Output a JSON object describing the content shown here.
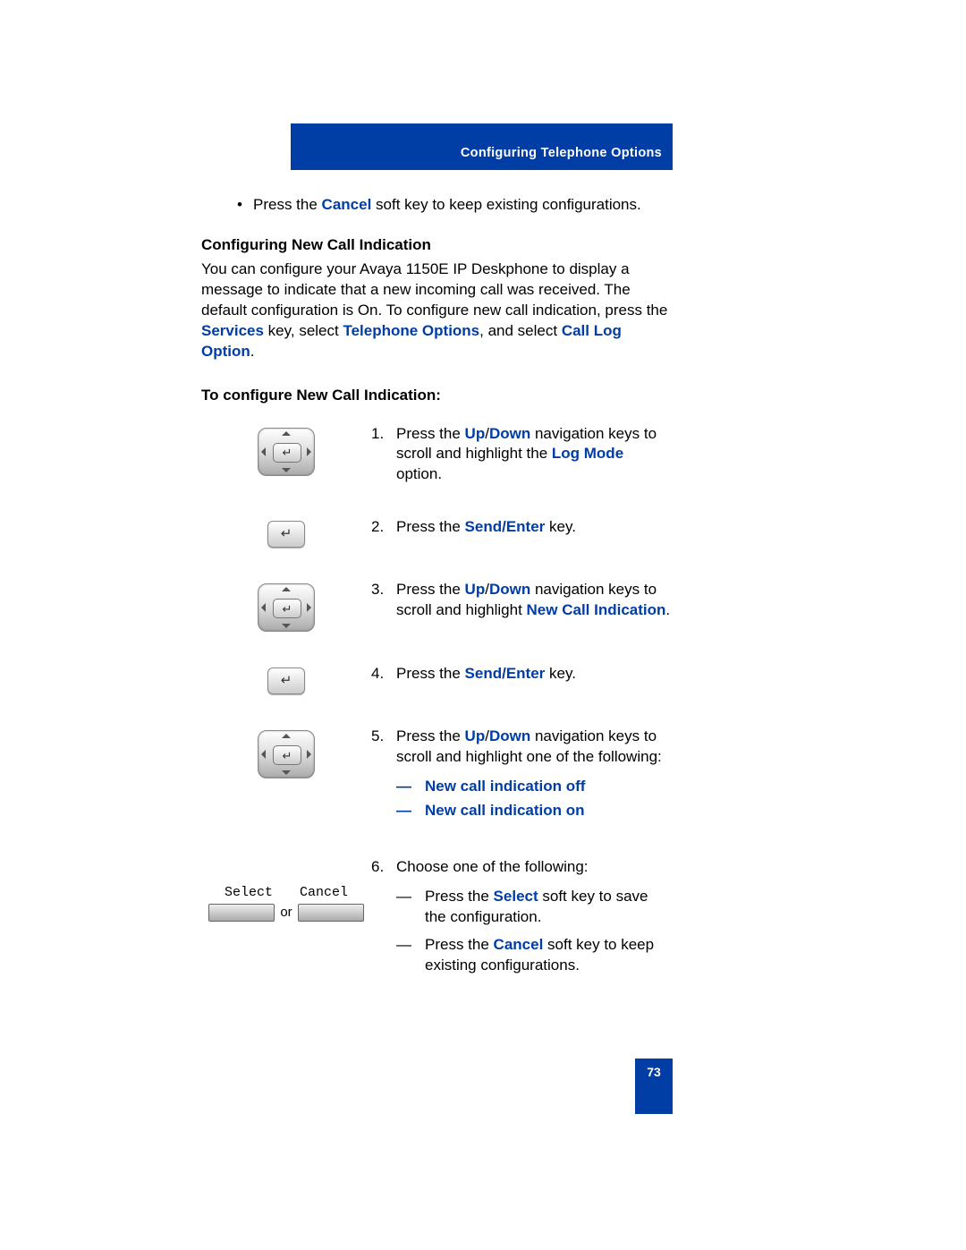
{
  "header": {
    "title": "Configuring Telephone Options"
  },
  "intro_bullet": {
    "prefix": "Press the ",
    "key": "Cancel",
    "suffix": " soft key to keep existing configurations."
  },
  "section_heading": "Configuring New Call Indication",
  "intro_para": {
    "line1": "You can configure your Avaya 1150E IP Deskphone to display a message to indicate that a new incoming call was received. The default configuration is On. To configure new call indication, press the ",
    "services": "Services",
    "mid1": " key, select ",
    "tel_opt": "Telephone Options",
    "mid2": ", and select ",
    "call_log": "Call Log Option",
    "end": "."
  },
  "sub_heading": "To configure New Call Indication:",
  "steps": {
    "s1": {
      "num": "1.",
      "p1": "Press the ",
      "k1": "Up",
      "slash": "/",
      "k2": "Down",
      "p2": " navigation keys to scroll and highlight the ",
      "k3": "Log Mode",
      "p3": " option."
    },
    "s2": {
      "num": "2.",
      "p1": "Press the ",
      "k1": "Send/Enter",
      "p2": " key."
    },
    "s3": {
      "num": "3.",
      "p1": "Press the ",
      "k1": "Up",
      "slash": "/",
      "k2": "Down",
      "p2": " navigation keys to scroll and highlight ",
      "k3": "New Call Indication",
      "p3": "."
    },
    "s4": {
      "num": "4.",
      "p1": "Press the ",
      "k1": "Send/Enter",
      "p2": " key."
    },
    "s5": {
      "num": "5.",
      "p1": "Press the ",
      "k1": "Up",
      "slash": "/",
      "k2": "Down",
      "p2": " navigation keys to scroll and highlight one of the following:",
      "opt1_dash": "—",
      "opt1": "New call indication off",
      "opt2_dash": "—",
      "opt2": "New call indication on"
    },
    "s6": {
      "num": "6.",
      "p1": "Choose one of the following:",
      "a_dash": "—",
      "a_p1": "Press the ",
      "a_k": "Select",
      "a_p2": " soft key to save the configuration.",
      "b_dash": "—",
      "b_p1": "Press the ",
      "b_k": "Cancel",
      "b_p2": " soft key to keep existing configurations."
    }
  },
  "softkeys": {
    "select": "Select",
    "cancel": "Cancel",
    "or": "or"
  },
  "page_number": "73"
}
